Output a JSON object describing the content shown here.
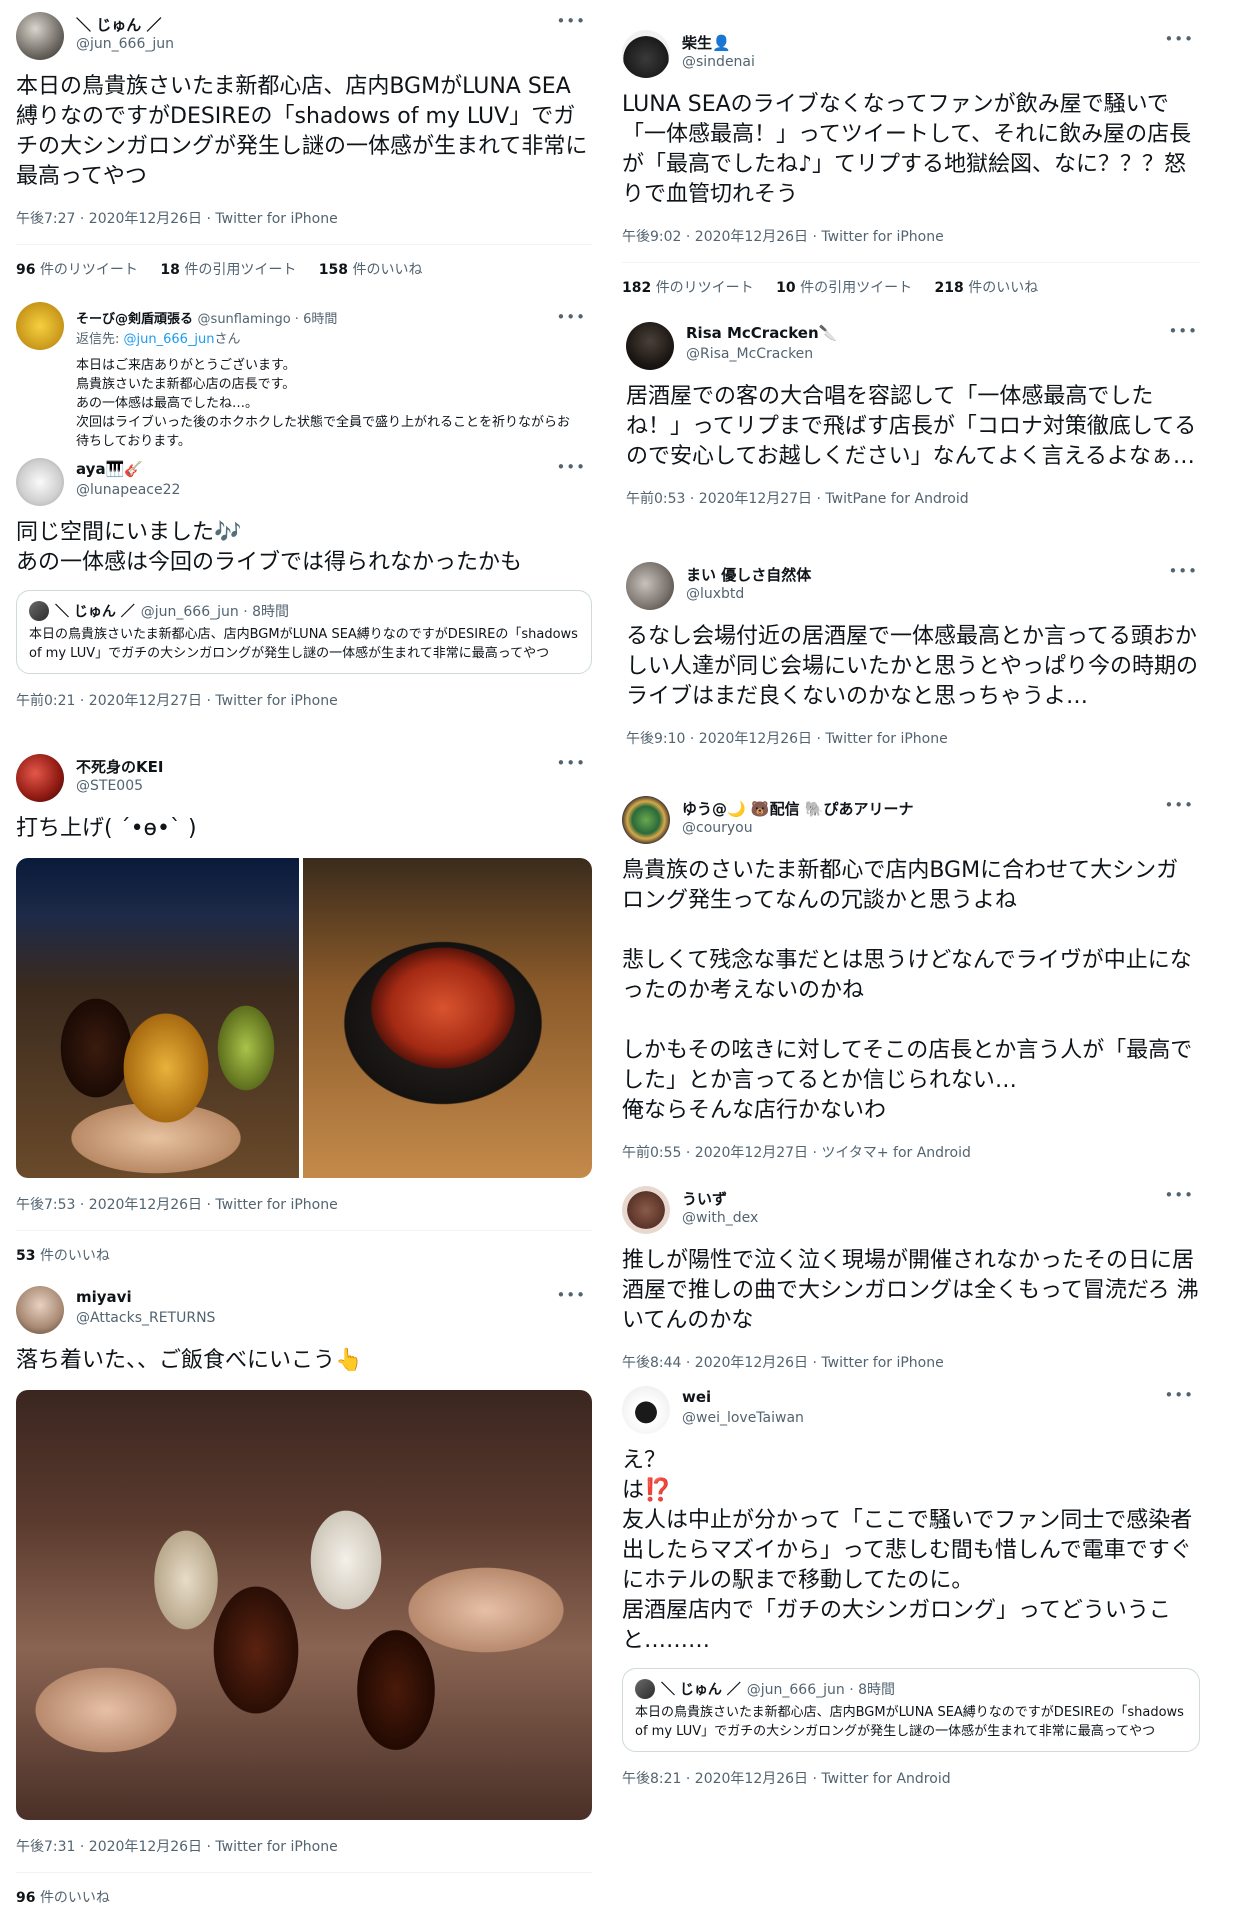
{
  "tweets": {
    "jun": {
      "name": "＼ じゅん ／",
      "handle": "@jun_666_jun",
      "text": "本日の鳥貴族さいたま新都心店、店内BGMがLUNA SEA縛りなのですがDESIREの「shadows of my LUV」でガチの大シンガロングが発生し謎の一体感が生まれて非常に最高ってやつ",
      "meta": "午後7:27 · 2020年12月26日 · Twitter for iPhone",
      "rt": "96",
      "rt_label": "件のリツイート",
      "qt": "18",
      "qt_label": "件の引用ツイート",
      "likes": "158",
      "likes_label": "件のいいね"
    },
    "sorbi": {
      "name": "そーび@剣盾頑張る",
      "handle": "@sunflamingo · 6時間",
      "reply_prefix": "返信先: ",
      "reply_to": "@jun_666_jun",
      "reply_suffix": "さん",
      "text": "本日はご来店ありがとうございます。\n鳥貴族さいたま新都心店の店長です。\nあの一体感は最高でしたね…。\n次回はライブいった後のホクホクした状態で全員で盛り上がれることを祈りながらお待ちしております。"
    },
    "aya": {
      "name": "aya🎹🎸",
      "handle": "@lunapeace22",
      "text": "同じ空間にいました🎶\nあの一体感は今回のライブでは得られなかったかも",
      "quote_name": "＼ じゅん ／",
      "quote_handle": "@jun_666_jun · 8時間",
      "quote_text": "本日の鳥貴族さいたま新都心店、店内BGMがLUNA SEA縛りなのですがDESIREの「shadows of my LUV」でガチの大シンガロングが発生し謎の一体感が生まれて非常に最高ってやつ",
      "meta": "午前0:21 · 2020年12月27日 · Twitter for iPhone"
    },
    "kei": {
      "name": "不死身のKEI",
      "handle": "@STE005",
      "text": "打ち上げ( ´•ө•` )",
      "meta": "午後7:53 · 2020年12月26日 · Twitter for iPhone",
      "likes": "53",
      "likes_label": "件のいいね"
    },
    "miyavi": {
      "name": "miyavi",
      "handle": "@Attacks_RETURNS",
      "text": "落ち着いた、、ご飯食べにいこう👆",
      "meta": "午後7:31 · 2020年12月26日 · Twitter for iPhone",
      "likes": "96",
      "likes_label": "件のいいね"
    },
    "sindenai": {
      "name": "柴生👤",
      "handle": "@sindenai",
      "text": "LUNA SEAのライブなくなってファンが飲み屋で騒いで「一体感最高！」ってツイートして、それに飲み屋の店長が「最高でしたね♪」てリプする地獄絵図、なに？？？怒りで血管切れそう",
      "meta": "午後9:02 · 2020年12月26日 · Twitter for iPhone",
      "rt": "182",
      "rt_label": "件のリツイート",
      "qt": "10",
      "qt_label": "件の引用ツイート",
      "likes": "218",
      "likes_label": "件のいいね"
    },
    "risa": {
      "name": "Risa McCracken🔪",
      "handle": "@Risa_McCracken",
      "text": "居酒屋での客の大合唱を容認して「一体感最高でしたね！」ってリプまで飛ばす店長が「コロナ対策徹底してるので安心してお越しください」なんてよく言えるよなぁ…",
      "meta": "午前0:53 · 2020年12月27日 · TwitPane for Android"
    },
    "mai": {
      "name": "まい 優しさ自然体",
      "handle": "@luxbtd",
      "text": "るなし会場付近の居酒屋で一体感最高とか言ってる頭おかしい人達が同じ会場にいたかと思うとやっぱり今の時期のライブはまだ良くないのかなと思っちゃうよ…",
      "meta": "午後9:10 · 2020年12月26日 · Twitter for iPhone"
    },
    "yuu": {
      "name": "ゆう@🌙 🐻配信 🐘ぴあアリーナ",
      "handle": "@couryou",
      "text": "鳥貴族のさいたま新都心で店内BGMに合わせて大シンガロング発生ってなんの冗談かと思うよね\n\n悲しくて残念な事だとは思うけどなんでライヴが中止になったのか考えないのかね\n\nしかもその呟きに対してそこの店長とか言う人が「最高でした」とか言ってるとか信じられない…\n俺ならそんな店行かないわ",
      "meta": "午前0:55 · 2020年12月27日 · ツイタマ+ for Android"
    },
    "uizu": {
      "name": "ういず",
      "handle": "@with_dex",
      "text": "推しが陽性で泣く泣く現場が開催されなかったその日に居酒屋で推しの曲で大シンガロングは全くもって冒涜だろ 沸いてんのかな",
      "meta": "午後8:44 · 2020年12月26日 · Twitter for iPhone"
    },
    "wei": {
      "name": "wei",
      "handle": "@wei_loveTaiwan",
      "text": "え？\nは⁉️\n友人は中止が分かって「ここで騒いでファン同士で感染者出したらマズイから」って悲しむ間も惜しんで電車ですぐにホテルの駅まで移動してたのに。\n居酒屋店内で「ガチの大シンガロング」ってどういうこと………",
      "quote_name": "＼ じゅん ／",
      "quote_handle": "@jun_666_jun · 8時間",
      "quote_text": "本日の鳥貴族さいたま新都心店、店内BGMがLUNA SEA縛りなのですがDESIREの「shadows of my LUV」でガチの大シンガロングが発生し謎の一体感が生まれて非常に最高ってやつ",
      "meta": "午後8:21 · 2020年12月26日 · Twitter for Android"
    }
  },
  "icons": {
    "more": "more-dots-icon"
  },
  "colors": {
    "link": "#1d9bf0",
    "text": "#0f1419",
    "muted": "#536471",
    "border": "#eff3f4"
  }
}
